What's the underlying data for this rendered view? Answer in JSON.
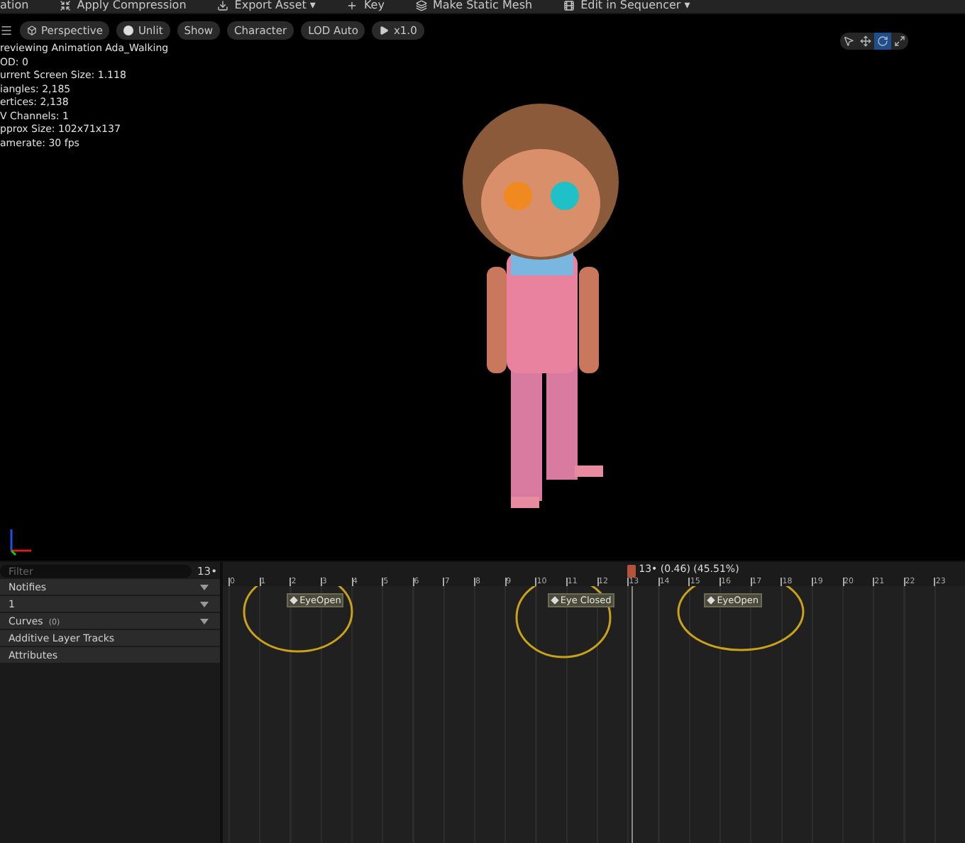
{
  "toolbar": {
    "items": [
      {
        "label": "ation"
      },
      {
        "label": "Apply Compression"
      },
      {
        "label": "Export Asset ▾"
      },
      {
        "label": "Key"
      },
      {
        "label": "Make Static Mesh"
      },
      {
        "label": "Edit in Sequencer ▾"
      }
    ]
  },
  "viewport": {
    "buttons": [
      {
        "label": "Perspective"
      },
      {
        "label": "Unlit"
      },
      {
        "label": "Show"
      },
      {
        "label": "Character"
      },
      {
        "label": "LOD Auto"
      },
      {
        "label": "x1.0"
      }
    ],
    "transform_tools": [
      {
        "selected": false
      },
      {
        "selected": false
      },
      {
        "selected": true
      },
      {
        "selected": false
      }
    ],
    "stats": [
      "reviewing Animation Ada_Walking",
      "OD: 0",
      "urrent Screen Size: 1.118",
      "iangles: 2,185",
      "ertices: 2,138",
      "V Channels: 1",
      "pprox Size: 102x71x137",
      "amerate: 30 fps"
    ]
  },
  "tracks_panel": {
    "filter": {
      "placeholder": "Filter"
    },
    "frame": "13•",
    "rows": [
      {
        "label": "Notifies",
        "count": "",
        "dropdown": true
      },
      {
        "label": "1",
        "count": "",
        "dropdown": true
      },
      {
        "label": "Curves",
        "count": "(0)",
        "dropdown": true
      },
      {
        "label": "Additive Layer Tracks",
        "count": "",
        "dropdown": false
      },
      {
        "label": "Attributes",
        "count": "",
        "dropdown": false
      }
    ]
  },
  "timeline": {
    "ticks": [
      "0",
      "1",
      "2",
      "3",
      "4",
      "5",
      "6",
      "7",
      "8",
      "9",
      "10",
      "11",
      "12",
      "13",
      "14",
      "15",
      "16",
      "17",
      "18",
      "19",
      "20",
      "21",
      "22",
      "23"
    ],
    "playhead": {
      "label": "13• (0.46) (45.51%)"
    },
    "notifies": [
      {
        "label": "EyeOpen"
      },
      {
        "label": "Eye Closed"
      },
      {
        "label": "EyeOpen"
      }
    ]
  }
}
